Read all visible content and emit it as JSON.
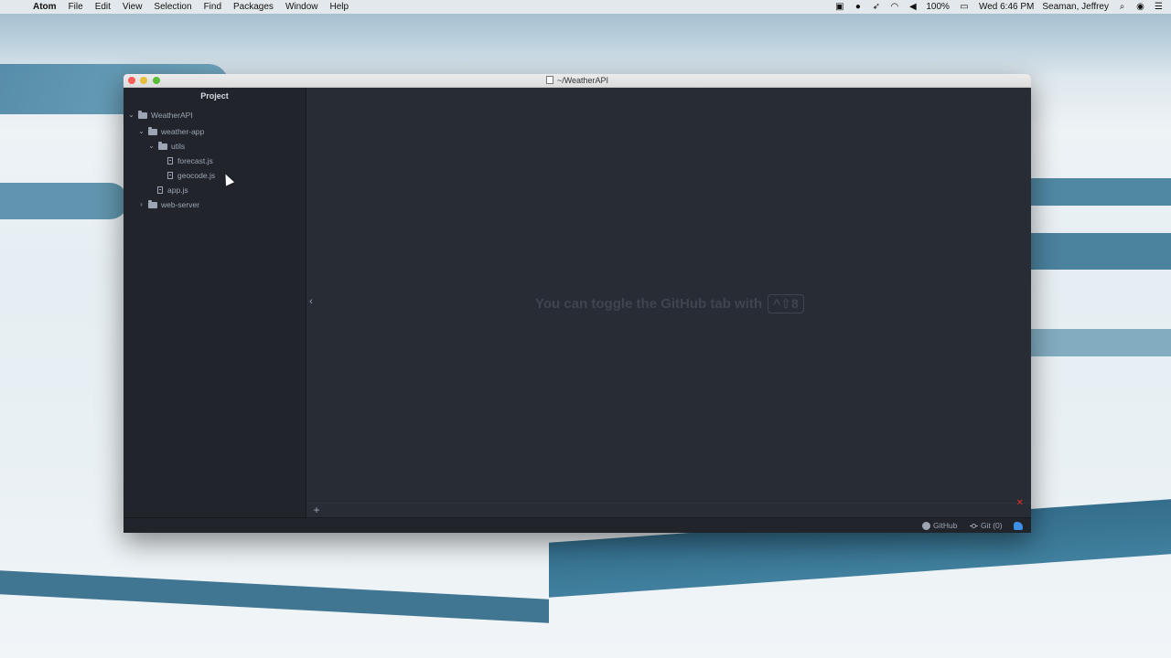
{
  "menubar": {
    "app_name": "Atom",
    "items": [
      "File",
      "Edit",
      "View",
      "Selection",
      "Find",
      "Packages",
      "Window",
      "Help"
    ],
    "battery": "100%",
    "clock": "Wed 6:46 PM",
    "user": "Seaman, Jeffrey",
    "icons": [
      "screen-record-icon",
      "grammarly-icon",
      "feather-icon",
      "wifi-icon",
      "volume-icon",
      "battery-icon",
      "search-icon",
      "siri-icon",
      "notification-center-icon"
    ]
  },
  "window": {
    "title": "~/WeatherAPI"
  },
  "tree_view": {
    "title": "Project",
    "root": "WeatherAPI",
    "items": {
      "weather_app": "weather-app",
      "utils": "utils",
      "forecast": "forecast.js",
      "geocode": "geocode.js",
      "app": "app.js",
      "web_server": "web-server"
    }
  },
  "editor": {
    "hint_text": "You can toggle the GitHub tab with",
    "hint_shortcut": "^⇧8"
  },
  "dock": {
    "add_label": "+",
    "close_label": "✕"
  },
  "statusbar": {
    "github_label": "GitHub",
    "git_label": "Git (0)"
  },
  "colors": {
    "editor_bg": "#282c34",
    "tree_bg": "#21252b",
    "text": "#9da5b4",
    "accent_close": "#e02c2c",
    "squirrel": "#3d8fe3"
  }
}
